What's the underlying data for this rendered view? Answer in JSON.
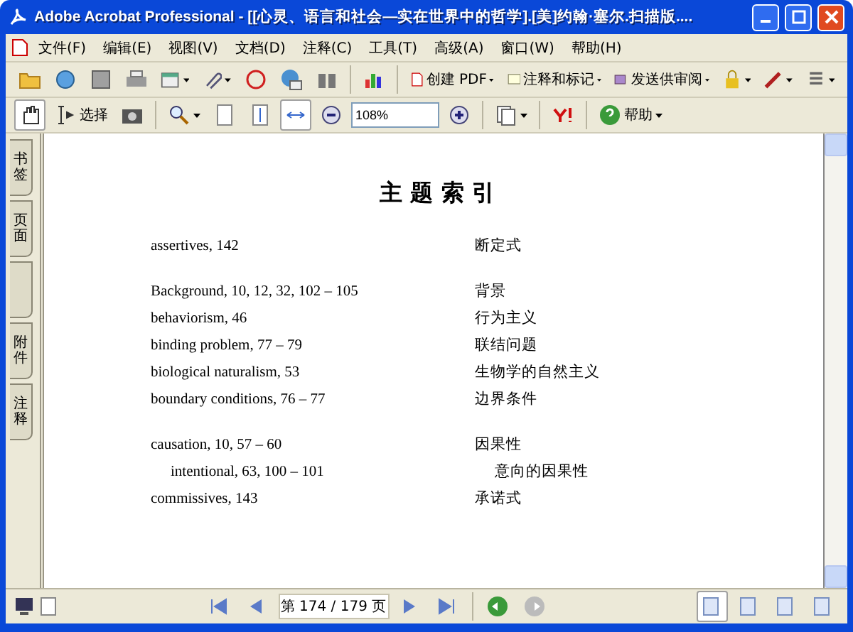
{
  "window": {
    "title": "Adobe Acrobat Professional - [[心灵、语言和社会—实在世界中的哲学].[美]约翰·塞尔.扫描版...."
  },
  "menu": [
    "文件(F)",
    "编辑(E)",
    "视图(V)",
    "文档(D)",
    "注释(C)",
    "工具(T)",
    "高级(A)",
    "窗口(W)",
    "帮助(H)"
  ],
  "toolbar_1": [
    {
      "kind": "icon"
    },
    {
      "kind": "icon"
    },
    {
      "kind": "icon"
    },
    {
      "kind": "icon"
    },
    {
      "kind": "icon",
      "menu": true
    },
    {
      "kind": "icon",
      "menu": true
    },
    {
      "kind": "icon"
    },
    {
      "kind": "icon"
    },
    {
      "kind": "icon"
    },
    {
      "kind": "sep"
    },
    {
      "kind": "icon"
    },
    {
      "kind": "sep"
    },
    {
      "kind": "label",
      "label": "创建 PDF",
      "menu": true
    },
    {
      "kind": "label",
      "label": "注释和标记",
      "menu": true
    },
    {
      "kind": "label",
      "label": "发送供审阅",
      "menu": true
    },
    {
      "kind": "icon",
      "menu": true
    },
    {
      "kind": "icon",
      "menu": true
    },
    {
      "kind": "icon",
      "menu": true
    }
  ],
  "toolbar_2": [
    {
      "kind": "icon",
      "selected": true
    },
    {
      "kind": "label",
      "label": "选择",
      "selected": false
    },
    {
      "kind": "icon",
      "selected": false
    },
    {
      "kind": "sep"
    },
    {
      "kind": "icon",
      "menu": true,
      "selected": false
    },
    {
      "kind": "icon",
      "selected": false
    },
    {
      "kind": "icon",
      "selected": false
    },
    {
      "kind": "icon",
      "selected": true
    },
    {
      "kind": "icon",
      "selected": false
    },
    {
      "kind": "zoomfield",
      "value": "108%"
    },
    {
      "kind": "icon",
      "selected": false
    },
    {
      "kind": "sep"
    },
    {
      "kind": "icon",
      "menu": true,
      "selected": false
    },
    {
      "kind": "sep"
    },
    {
      "kind": "icon",
      "selected": false
    },
    {
      "kind": "sep"
    },
    {
      "kind": "label",
      "label": "帮助",
      "menu": true,
      "selected": false
    }
  ],
  "side_tabs": [
    {
      "kind": "label",
      "label": "书签"
    },
    {
      "kind": "label",
      "label": "页面"
    },
    {
      "kind": "blank"
    },
    {
      "kind": "label",
      "label": "附件"
    },
    {
      "kind": "label",
      "label": "注释"
    }
  ],
  "page": {
    "heading": "主 题 索 引",
    "groups": [
      [
        {
          "term": "assertives, 142",
          "translation": "断定式",
          "indented": false
        }
      ],
      [
        {
          "term": "Background, 10, 12, 32, 102 – 105",
          "translation": "背景",
          "indented": false
        },
        {
          "term": "behaviorism, 46",
          "translation": "行为主义",
          "indented": false
        },
        {
          "term": "binding problem, 77 – 79",
          "translation": "联结问题",
          "indented": false
        },
        {
          "term": "biological naturalism, 53",
          "translation": "生物学的自然主义",
          "indented": false
        },
        {
          "term": "boundary conditions, 76 – 77",
          "translation": "边界条件",
          "indented": false
        }
      ],
      [
        {
          "term": "causation, 10, 57 – 60",
          "translation": "因果性",
          "indented": false
        },
        {
          "term": "intentional, 63, 100 – 101",
          "translation": "意向的因果性",
          "indented": true
        },
        {
          "term": "commissives, 143",
          "translation": "承诺式",
          "indented": false
        }
      ]
    ]
  },
  "page_nav": {
    "label": "第 174 / 179 页"
  },
  "views": [
    {
      "selected": true
    },
    {
      "selected": false
    },
    {
      "selected": false
    },
    {
      "selected": false
    }
  ]
}
